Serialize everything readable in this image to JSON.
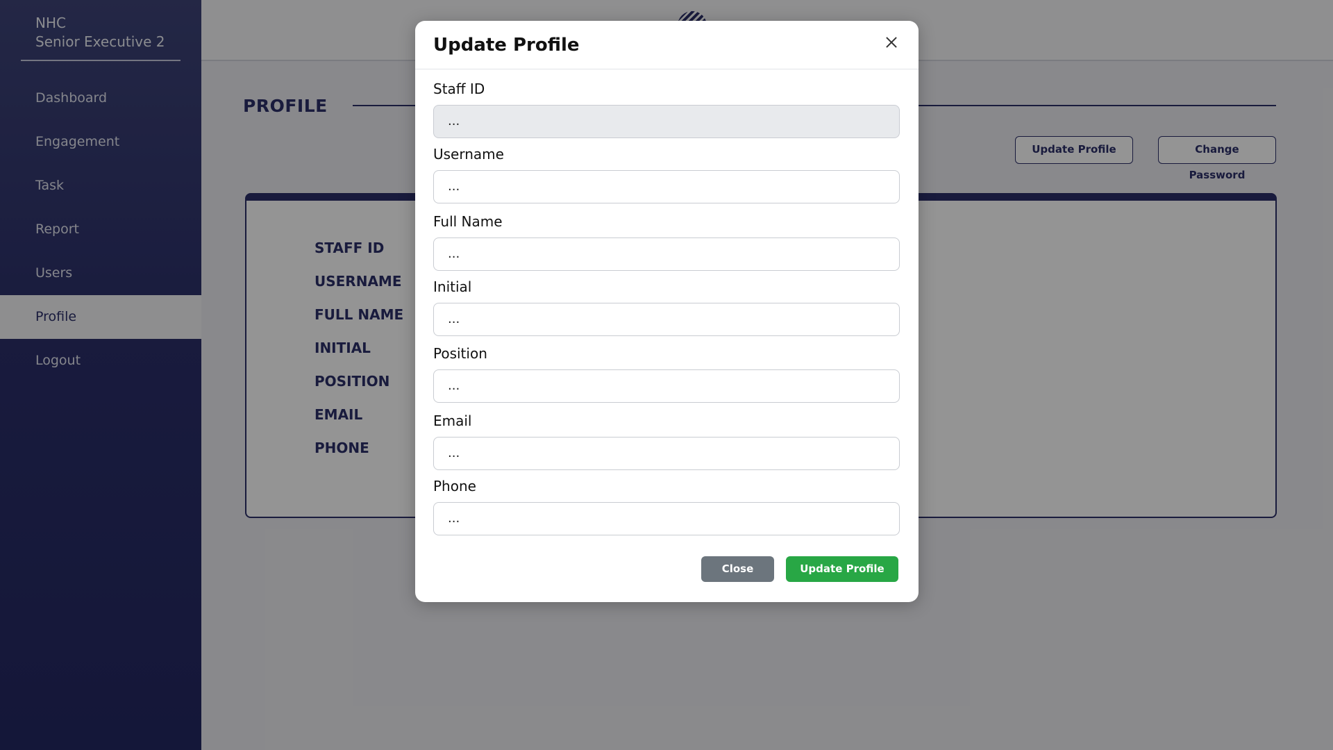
{
  "sidebar": {
    "org": "NHC",
    "role": "Senior Executive 2",
    "items": [
      {
        "label": "Dashboard"
      },
      {
        "label": "Engagement"
      },
      {
        "label": "Task"
      },
      {
        "label": "Report"
      },
      {
        "label": "Users"
      },
      {
        "label": "Profile",
        "active": true
      },
      {
        "label": "Logout"
      }
    ]
  },
  "page": {
    "title": "PROFILE",
    "update_profile_label": "Update Profile",
    "change_password_label": "Change Password",
    "card_labels": [
      "STAFF ID",
      "USERNAME",
      "FULL NAME",
      "INITIAL",
      "POSITION",
      "EMAIL",
      "PHONE"
    ]
  },
  "modal": {
    "title": "Update Profile",
    "fields": [
      {
        "label": "Staff ID",
        "value": "...",
        "readonly": true
      },
      {
        "label": "Username",
        "value": "..."
      },
      {
        "label": "Full Name",
        "value": "..."
      },
      {
        "label": "Initial",
        "value": "..."
      },
      {
        "label": "Position",
        "value": "..."
      },
      {
        "label": "Email",
        "value": "..."
      },
      {
        "label": "Phone",
        "value": "..."
      }
    ],
    "close_label": "Close",
    "submit_label": "Update Profile"
  },
  "colors": {
    "brand": "#2b2f6a",
    "success": "#28a745",
    "secondary": "#6c757d"
  }
}
